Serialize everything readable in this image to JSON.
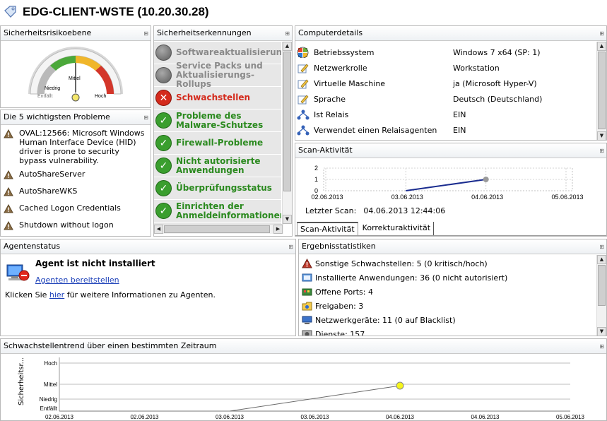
{
  "header": {
    "title": "EDG-CLIENT-WSTE (10.20.30.28)"
  },
  "risk": {
    "title": "Sicherheitsrisikoebene",
    "labels": {
      "mittel": "Mittel",
      "niedrig": "Niedrig",
      "hoch": "Hoch",
      "entfaellt": "Entfällt"
    },
    "level": "Mittel"
  },
  "top5": {
    "title": "Die 5 wichtigsten Probleme",
    "items": [
      "OVAL:12566: Microsoft Windows Human Interface Device (HID) driver is prone to security bypass vulnerability.",
      "AutoShareServer",
      "AutoShareWKS",
      "Cached Logon Credentials",
      "Shutdown without logon"
    ]
  },
  "security": {
    "title": "Sicherheitserkennungen",
    "items": [
      {
        "label": "Softwareaktualisierungen",
        "status": "gray"
      },
      {
        "label": "Service Packs und Aktualisierungs-Rollups",
        "status": "gray"
      },
      {
        "label": "Schwachstellen",
        "status": "red"
      },
      {
        "label": "Probleme des Malware-Schutzes",
        "status": "green"
      },
      {
        "label": "Firewall-Probleme",
        "status": "green"
      },
      {
        "label": "Nicht autorisierte Anwendungen",
        "status": "green"
      },
      {
        "label": "Überprüfungsstatus",
        "status": "green"
      },
      {
        "label": "Einrichten der Anmeldeinformationen",
        "status": "green"
      }
    ]
  },
  "details": {
    "title": "Computerdetails",
    "rows": [
      {
        "key": "Betriebssystem",
        "value": "Windows 7 x64 (SP: 1)",
        "icon": "windows-icon"
      },
      {
        "key": "Netzwerkrolle",
        "value": "Workstation",
        "icon": "edit-icon"
      },
      {
        "key": "Virtuelle Maschine",
        "value": "ja (Microsoft Hyper-V)",
        "icon": "edit-icon"
      },
      {
        "key": "Sprache",
        "value": "Deutsch (Deutschland)",
        "icon": "edit-icon"
      },
      {
        "key": "Ist Relais",
        "value": "EIN",
        "icon": "relay-icon"
      },
      {
        "key": "Verwendet einen Relaisagenten",
        "value": "EIN",
        "icon": "relay-icon"
      }
    ]
  },
  "scan": {
    "title": "Scan-Aktivität",
    "last_label": "Letzter Scan:",
    "last_value": "04.06.2013 12:44:06",
    "tabs": [
      "Scan-Aktivität",
      "Korrekturaktivität"
    ],
    "colors": {
      "line": "#1a2c8f",
      "point": "#9a9a9a"
    }
  },
  "agent": {
    "title": "Agentenstatus",
    "heading": "Agent ist nicht installiert",
    "link": "Agenten bereitstellen",
    "info_before": "Klicken Sie ",
    "info_link": "hier",
    "info_after": " für weitere Informationen zu Agenten."
  },
  "results": {
    "title": "Ergebnisstatistiken",
    "items": [
      {
        "text": "Sonstige Schwachstellen: 5 (0 kritisch/hoch)",
        "icon": "warning-icon"
      },
      {
        "text": "Installierte Anwendungen: 36 (0 nicht autorisiert)",
        "icon": "applications-icon"
      },
      {
        "text": "Offene Ports: 4",
        "icon": "ports-icon"
      },
      {
        "text": "Freigaben: 3",
        "icon": "shares-icon"
      },
      {
        "text": "Netzwerkgeräte: 11 (0 auf Blacklist)",
        "icon": "network-devices-icon"
      },
      {
        "text": "Dienste: 157",
        "icon": "services-icon"
      }
    ]
  },
  "trend": {
    "title": "Schwachstellentrend über einen bestimmten Zeitraum",
    "ylabel": "Sicherheitsr...",
    "colors": {
      "line": "#6a6a6a",
      "point": "#f5f51c"
    }
  },
  "chart_data": [
    {
      "type": "line",
      "title": "Scan-Aktivität",
      "x": [
        "02.06.2013",
        "03.06.2013",
        "04.06.2013",
        "05.06.2013"
      ],
      "yticks": [
        "0",
        "1",
        "2"
      ],
      "ylim": [
        0,
        2
      ],
      "series": [
        {
          "points": [
            {
              "x": "03.06.2013",
              "y": 0
            },
            {
              "x": "04.06.2013",
              "y": 1
            }
          ]
        }
      ]
    },
    {
      "type": "line",
      "title": "Schwachstellentrend über einen bestimmten Zeitraum",
      "ylabel": "Sicherheitsr...",
      "x": [
        "02.06.2013",
        "02.06.2013",
        "03.06.2013",
        "03.06.2013",
        "04.06.2013",
        "04.06.2013",
        "05.06.2013"
      ],
      "yticks": [
        "Entfällt",
        "Niedrig",
        "Mittel",
        "Hoch"
      ],
      "series": [
        {
          "points": [
            {
              "x": "03.06.2013",
              "y": "Entfällt"
            },
            {
              "x": "04.06.2013",
              "y": "Mittel"
            }
          ]
        }
      ]
    }
  ]
}
